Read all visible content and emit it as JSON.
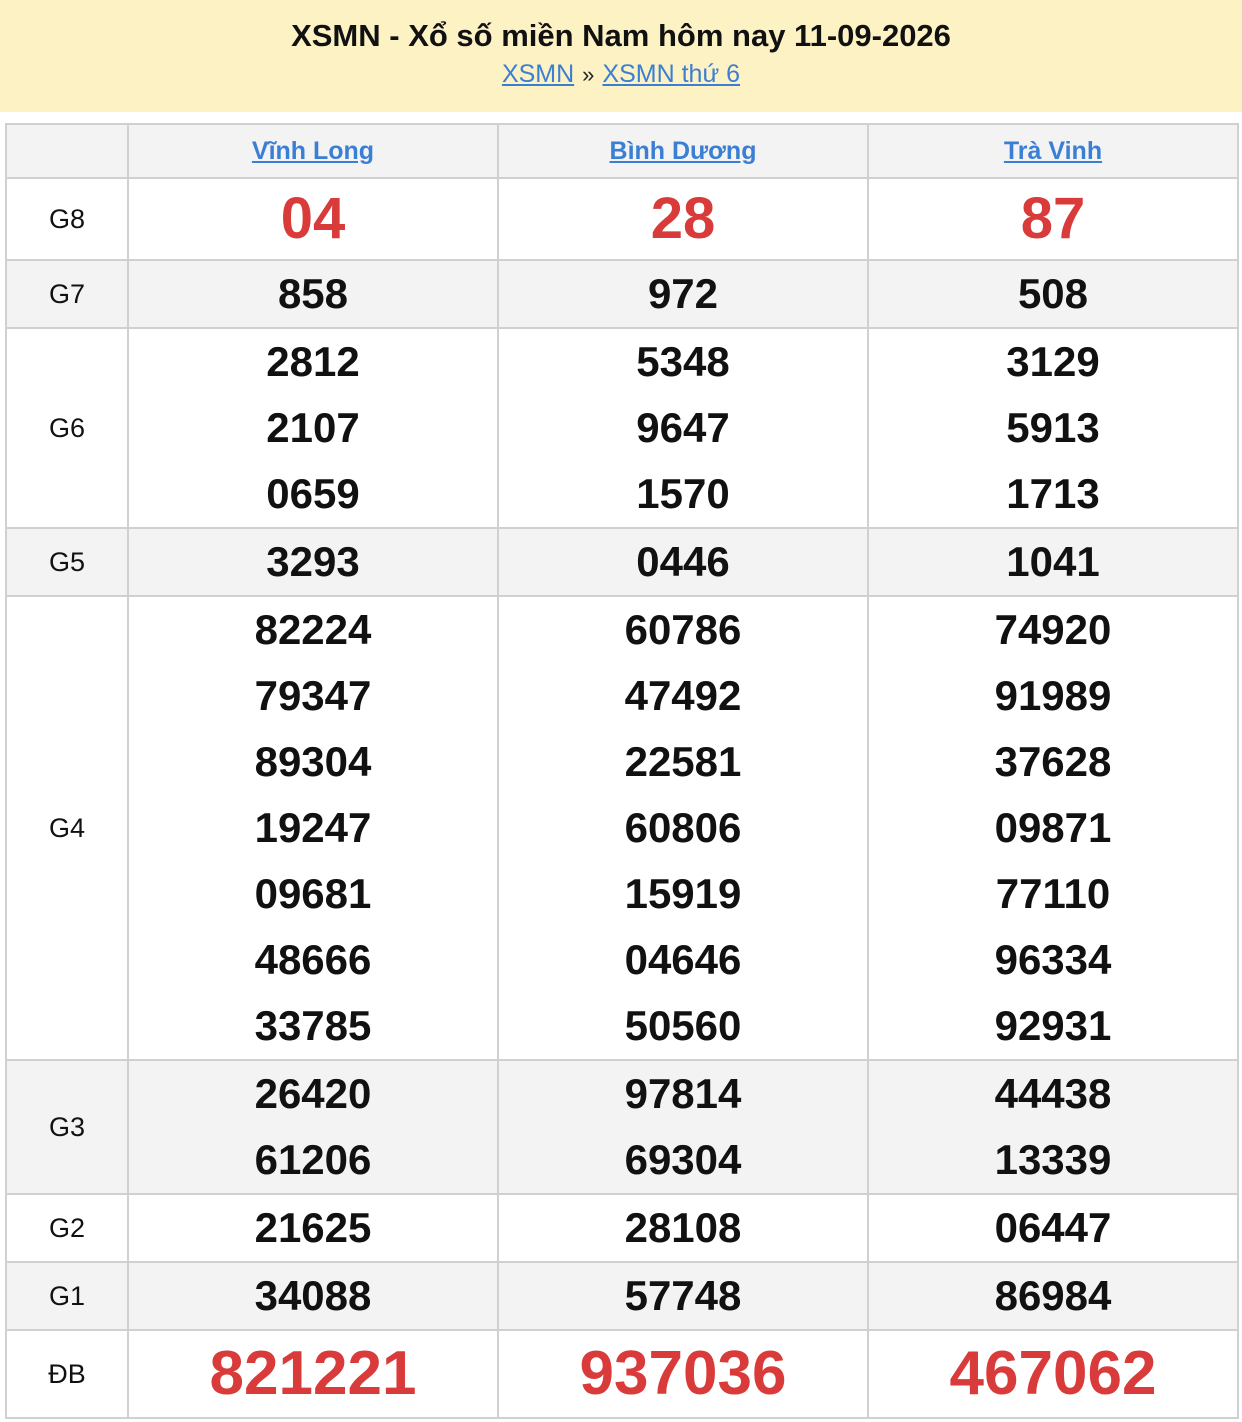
{
  "header": {
    "title": "XSMN - Xổ số miền Nam hôm nay 11-09-2026",
    "crumb1": "XSMN",
    "sep": "»",
    "crumb2": "XSMN thứ 6"
  },
  "provinces": [
    "Vĩnh Long",
    "Bình Dương",
    "Trà Vinh"
  ],
  "labels": {
    "g8": "G8",
    "g7": "G7",
    "g6": "G6",
    "g5": "G5",
    "g4": "G4",
    "g3": "G3",
    "g2": "G2",
    "g1": "G1",
    "db": "ĐB"
  },
  "prizes": {
    "g8": [
      [
        "04"
      ],
      [
        "28"
      ],
      [
        "87"
      ]
    ],
    "g7": [
      [
        "858"
      ],
      [
        "972"
      ],
      [
        "508"
      ]
    ],
    "g6": [
      [
        "2812",
        "2107",
        "0659"
      ],
      [
        "5348",
        "9647",
        "1570"
      ],
      [
        "3129",
        "5913",
        "1713"
      ]
    ],
    "g5": [
      [
        "3293"
      ],
      [
        "0446"
      ],
      [
        "1041"
      ]
    ],
    "g4": [
      [
        "82224",
        "79347",
        "89304",
        "19247",
        "09681",
        "48666",
        "33785"
      ],
      [
        "60786",
        "47492",
        "22581",
        "60806",
        "15919",
        "04646",
        "50560"
      ],
      [
        "74920",
        "91989",
        "37628",
        "09871",
        "77110",
        "96334",
        "92931"
      ]
    ],
    "g3": [
      [
        "26420",
        "61206"
      ],
      [
        "97814",
        "69304"
      ],
      [
        "44438",
        "13339"
      ]
    ],
    "g2": [
      [
        "21625"
      ],
      [
        "28108"
      ],
      [
        "06447"
      ]
    ],
    "g1": [
      [
        "34088"
      ],
      [
        "57748"
      ],
      [
        "86984"
      ]
    ],
    "db": [
      [
        "821221"
      ],
      [
        "937036"
      ],
      [
        "467062"
      ]
    ]
  },
  "colors": {
    "accent_red": "#d93a3a",
    "link_blue": "#3b7fd4",
    "header_bg": "#fcf2c4"
  }
}
